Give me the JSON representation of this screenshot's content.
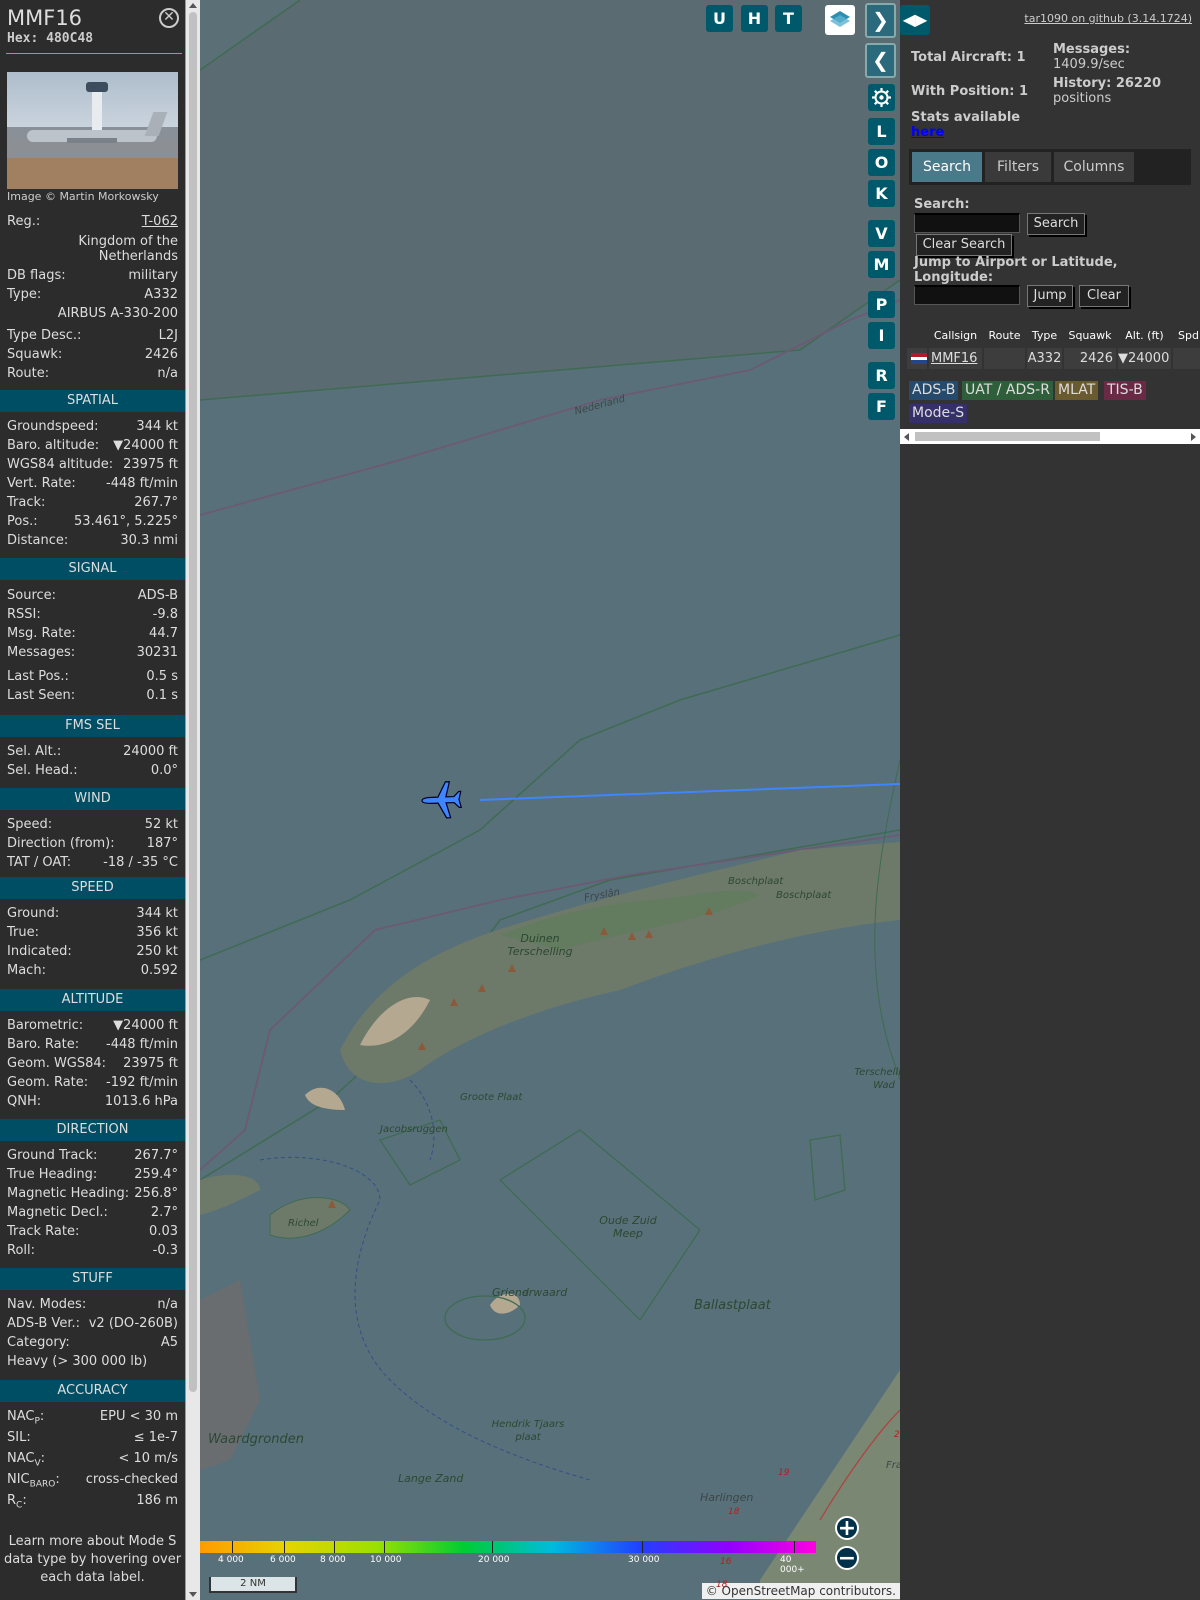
{
  "sidebar": {
    "callsign": "MMF16",
    "hex_label": "Hex:",
    "hex": "480C48",
    "close_glyph": "✕",
    "photo_caption": "Image © Martin Morkowsky",
    "top_rows": [
      {
        "label": "Reg.:",
        "value": "T-062"
      },
      {
        "label": "",
        "value": "Kingdom of the Netherlands"
      },
      {
        "label": "DB flags:",
        "value": "military"
      },
      {
        "label": "Type:",
        "value": "A332"
      },
      {
        "label": "",
        "value": "AIRBUS A-330-200"
      },
      {
        "label": "Type Desc.:",
        "value": "L2J"
      },
      {
        "label": "Squawk:",
        "value": "2426"
      },
      {
        "label": "Route:",
        "value": "n/a"
      }
    ],
    "sections": {
      "spatial": {
        "title": "SPATIAL",
        "rows": [
          {
            "label": "Groundspeed:",
            "value": "344 kt"
          },
          {
            "label": "Baro. altitude:",
            "value": "▼24000 ft"
          },
          {
            "label": "WGS84 altitude:",
            "value": "23975 ft"
          },
          {
            "label": "Vert. Rate:",
            "value": "-448 ft/min"
          },
          {
            "label": "Track:",
            "value": "267.7°"
          },
          {
            "label": "Pos.:",
            "value": "53.461°, 5.225°"
          },
          {
            "label": "Distance:",
            "value": "30.3 nmi"
          }
        ]
      },
      "signal": {
        "title": "SIGNAL",
        "rows": [
          {
            "label": "Source:",
            "value": "ADS-B"
          },
          {
            "label": "RSSI:",
            "value": "-9.8"
          },
          {
            "label": "Msg. Rate:",
            "value": "44.7"
          },
          {
            "label": "Messages:",
            "value": "30231"
          },
          {
            "label": "Last Pos.:",
            "value": "0.5 s"
          },
          {
            "label": "Last Seen:",
            "value": "0.1 s"
          }
        ]
      },
      "fms": {
        "title": "FMS SEL",
        "rows": [
          {
            "label": "Sel. Alt.:",
            "value": "24000 ft"
          },
          {
            "label": "Sel. Head.:",
            "value": "0.0°"
          }
        ]
      },
      "wind": {
        "title": "WIND",
        "rows": [
          {
            "label": "Speed:",
            "value": "52 kt"
          },
          {
            "label": "Direction (from):",
            "value": "187°"
          },
          {
            "label": "TAT / OAT:",
            "value": "-18 / -35 °C"
          }
        ]
      },
      "speed": {
        "title": "SPEED",
        "rows": [
          {
            "label": "Ground:",
            "value": "344 kt"
          },
          {
            "label": "True:",
            "value": "356 kt"
          },
          {
            "label": "Indicated:",
            "value": "250 kt"
          },
          {
            "label": "Mach:",
            "value": "0.592"
          }
        ]
      },
      "altitude": {
        "title": "ALTITUDE",
        "rows": [
          {
            "label": "Barometric:",
            "value": "▼24000 ft"
          },
          {
            "label": "Baro. Rate:",
            "value": "-448 ft/min"
          },
          {
            "label": "Geom. WGS84:",
            "value": "23975 ft"
          },
          {
            "label": "Geom. Rate:",
            "value": "-192 ft/min"
          },
          {
            "label": "QNH:",
            "value": "1013.6 hPa"
          }
        ]
      },
      "direction": {
        "title": "DIRECTION",
        "rows": [
          {
            "label": "Ground Track:",
            "value": "267.7°"
          },
          {
            "label": "True Heading:",
            "value": "259.4°"
          },
          {
            "label": "Magnetic Heading:",
            "value": "256.8°"
          },
          {
            "label": "Magnetic Decl.:",
            "value": "2.7°"
          },
          {
            "label": "Track Rate:",
            "value": "0.03"
          },
          {
            "label": "Roll:",
            "value": "-0.3"
          }
        ]
      },
      "stuff": {
        "title": "STUFF",
        "rows": [
          {
            "label": "Nav. Modes:",
            "value": "n/a"
          },
          {
            "label": "ADS-B Ver.:",
            "value": "v2 (DO-260B)"
          },
          {
            "label": "Category:",
            "value": "A5"
          },
          {
            "label": "Heavy (> 300 000 lb)",
            "value": ""
          }
        ]
      },
      "accuracy": {
        "title": "ACCURACY",
        "rows": [
          {
            "label": "NAC",
            "sub": "P",
            "suffix": ":",
            "value": "EPU < 30 m"
          },
          {
            "label": "SIL:",
            "sub": "",
            "suffix": "",
            "value": "≤ 1e-7"
          },
          {
            "label": "NAC",
            "sub": "V",
            "suffix": ":",
            "value": "< 10 m/s"
          },
          {
            "label": "NIC",
            "sub": "BARO",
            "suffix": ":",
            "value": "cross-checked"
          },
          {
            "label": "R",
            "sub": "C",
            "suffix": ":",
            "value": "186 m"
          }
        ]
      }
    },
    "footer": "Learn more about Mode S data type by hovering over each data label."
  },
  "map": {
    "buttons_top": [
      "U",
      "H",
      "T"
    ],
    "side_buttons": [
      "L",
      "O",
      "K",
      "V",
      "M",
      "P",
      "I",
      "R",
      "F"
    ],
    "layers_icon": "layers-icon",
    "settings_icon": "gear-icon",
    "expand_glyph": "❯",
    "collapse_glyph": "❮",
    "zoom_in": "+",
    "zoom_out": "−",
    "labels": [
      "Nederland",
      "Fryslân",
      "Duinen Terschelling",
      "Boschplaat",
      "Boschplaat",
      "Groote Plaat",
      "Jacobsruggen",
      "Richel",
      "Oude Zuid Meep",
      "Griend",
      "erwaard",
      "Ballastplaat",
      "Hendrik Tjaars plaat",
      "Waardgronden",
      "Lange Zand",
      "Harlingen",
      "Terschelling Wad",
      "Fra"
    ],
    "altitude_scale": [
      "4 000",
      "6 000",
      "8 000",
      "10 000",
      "20 000",
      "30 000",
      "40 000+"
    ],
    "altitude_colors": [
      "#ff9b00",
      "#e6d400",
      "#9be000",
      "#00cc33",
      "#00bbdd",
      "#2040ff",
      "#9000ff",
      "#ff00e0"
    ],
    "scale_label": "2 NM",
    "attribution": "© OpenStreetMap contributors.",
    "road_numbers": [
      "19",
      "18",
      "16",
      "18",
      "2"
    ],
    "track_color": "#3f85ff"
  },
  "panel": {
    "toggle_glyph": "◀▶",
    "github": "tar1090 on github (3.14.1724)",
    "total_aircraft": "Total Aircraft: 1",
    "with_position": "With Position: 1",
    "stats_line": "Stats available",
    "stats_link": "here",
    "messages_label": "Messages:",
    "messages_value": "1409.9/sec",
    "history_label": "History: 26220",
    "history_value": "positions",
    "tabs": [
      "Search",
      "Filters",
      "Columns"
    ],
    "search_label": "Search:",
    "search_btn": "Search",
    "clear_search_btn": "Clear Search",
    "jump_label": "Jump to Airport or Latitude, Longitude:",
    "jump_btn": "Jump",
    "clear_btn": "Clear",
    "table_headers": [
      "",
      "Callsign",
      "Route",
      "Type",
      "Squawk",
      "Alt. (ft)",
      "Spd"
    ],
    "table_row": {
      "callsign": "MMF16",
      "route": "",
      "type": "A332",
      "squawk": "2426",
      "alt": "▼24000",
      "spd": ""
    },
    "flag_colors": [
      "#ae1c28",
      "#ffffff",
      "#21468b"
    ],
    "legend": [
      {
        "label": "ADS-B",
        "color": "#264a6b"
      },
      {
        "label": "UAT / ADS-R",
        "color": "#2f5e3a"
      },
      {
        "label": "MLAT",
        "color": "#6a5a30"
      },
      {
        "label": "TIS-B",
        "color": "#6a2a45"
      },
      {
        "label": "Mode-S",
        "color": "#35306a"
      }
    ]
  }
}
